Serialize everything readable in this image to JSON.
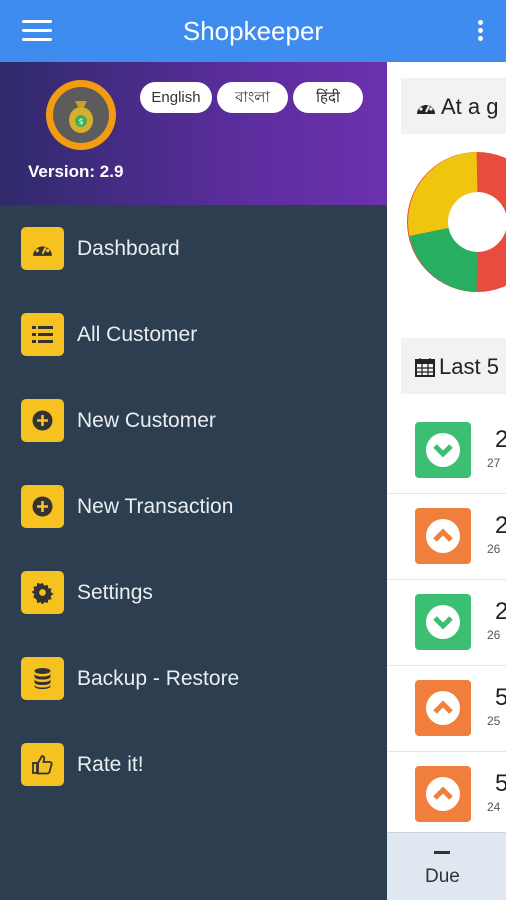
{
  "appbar": {
    "title": "Shopkeeper"
  },
  "drawer": {
    "version": "Version: 2.9",
    "languages": [
      "English",
      "বাংলা",
      "हिंदी"
    ],
    "items": [
      {
        "label": "Dashboard",
        "icon": "dashboard-icon"
      },
      {
        "label": "All Customer",
        "icon": "list-icon"
      },
      {
        "label": "New Customer",
        "icon": "plus-circle-icon"
      },
      {
        "label": "New Transaction",
        "icon": "plus-circle-icon"
      },
      {
        "label": "Settings",
        "icon": "gear-icon"
      },
      {
        "label": "Backup - Restore",
        "icon": "database-icon"
      },
      {
        "label": "Rate it!",
        "icon": "thumbs-up-icon"
      }
    ]
  },
  "main": {
    "glance_title": "At a g",
    "last_title": "Last 5",
    "transactions": [
      {
        "amount": "2",
        "date": "27",
        "direction": "down"
      },
      {
        "amount": "2",
        "date": "26",
        "direction": "up"
      },
      {
        "amount": "2",
        "date": "26",
        "direction": "down"
      },
      {
        "amount": "5",
        "date": "25",
        "direction": "up"
      },
      {
        "amount": "5",
        "date": "24",
        "direction": "up"
      }
    ],
    "tab_label": "Due"
  },
  "colors": {
    "appbar": "#3f8cf0",
    "drawer": "#2c3e50",
    "badge": "#f6c21f",
    "donut_red": "#e74c3c",
    "donut_yellow": "#f1c40f",
    "donut_green": "#27ae60",
    "in": "#3cbf73",
    "out": "#f07e3c"
  }
}
